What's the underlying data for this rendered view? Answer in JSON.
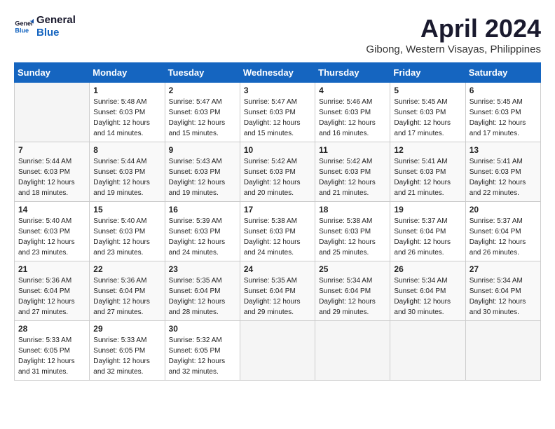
{
  "header": {
    "logo_line1": "General",
    "logo_line2": "Blue",
    "month_title": "April 2024",
    "subtitle": "Gibong, Western Visayas, Philippines"
  },
  "weekdays": [
    "Sunday",
    "Monday",
    "Tuesday",
    "Wednesday",
    "Thursday",
    "Friday",
    "Saturday"
  ],
  "weeks": [
    [
      {
        "day": "",
        "sunrise": "",
        "sunset": "",
        "daylight": ""
      },
      {
        "day": "1",
        "sunrise": "Sunrise: 5:48 AM",
        "sunset": "Sunset: 6:03 PM",
        "daylight": "Daylight: 12 hours and 14 minutes."
      },
      {
        "day": "2",
        "sunrise": "Sunrise: 5:47 AM",
        "sunset": "Sunset: 6:03 PM",
        "daylight": "Daylight: 12 hours and 15 minutes."
      },
      {
        "day": "3",
        "sunrise": "Sunrise: 5:47 AM",
        "sunset": "Sunset: 6:03 PM",
        "daylight": "Daylight: 12 hours and 15 minutes."
      },
      {
        "day": "4",
        "sunrise": "Sunrise: 5:46 AM",
        "sunset": "Sunset: 6:03 PM",
        "daylight": "Daylight: 12 hours and 16 minutes."
      },
      {
        "day": "5",
        "sunrise": "Sunrise: 5:45 AM",
        "sunset": "Sunset: 6:03 PM",
        "daylight": "Daylight: 12 hours and 17 minutes."
      },
      {
        "day": "6",
        "sunrise": "Sunrise: 5:45 AM",
        "sunset": "Sunset: 6:03 PM",
        "daylight": "Daylight: 12 hours and 17 minutes."
      }
    ],
    [
      {
        "day": "7",
        "sunrise": "Sunrise: 5:44 AM",
        "sunset": "Sunset: 6:03 PM",
        "daylight": "Daylight: 12 hours and 18 minutes."
      },
      {
        "day": "8",
        "sunrise": "Sunrise: 5:44 AM",
        "sunset": "Sunset: 6:03 PM",
        "daylight": "Daylight: 12 hours and 19 minutes."
      },
      {
        "day": "9",
        "sunrise": "Sunrise: 5:43 AM",
        "sunset": "Sunset: 6:03 PM",
        "daylight": "Daylight: 12 hours and 19 minutes."
      },
      {
        "day": "10",
        "sunrise": "Sunrise: 5:42 AM",
        "sunset": "Sunset: 6:03 PM",
        "daylight": "Daylight: 12 hours and 20 minutes."
      },
      {
        "day": "11",
        "sunrise": "Sunrise: 5:42 AM",
        "sunset": "Sunset: 6:03 PM",
        "daylight": "Daylight: 12 hours and 21 minutes."
      },
      {
        "day": "12",
        "sunrise": "Sunrise: 5:41 AM",
        "sunset": "Sunset: 6:03 PM",
        "daylight": "Daylight: 12 hours and 21 minutes."
      },
      {
        "day": "13",
        "sunrise": "Sunrise: 5:41 AM",
        "sunset": "Sunset: 6:03 PM",
        "daylight": "Daylight: 12 hours and 22 minutes."
      }
    ],
    [
      {
        "day": "14",
        "sunrise": "Sunrise: 5:40 AM",
        "sunset": "Sunset: 6:03 PM",
        "daylight": "Daylight: 12 hours and 23 minutes."
      },
      {
        "day": "15",
        "sunrise": "Sunrise: 5:40 AM",
        "sunset": "Sunset: 6:03 PM",
        "daylight": "Daylight: 12 hours and 23 minutes."
      },
      {
        "day": "16",
        "sunrise": "Sunrise: 5:39 AM",
        "sunset": "Sunset: 6:03 PM",
        "daylight": "Daylight: 12 hours and 24 minutes."
      },
      {
        "day": "17",
        "sunrise": "Sunrise: 5:38 AM",
        "sunset": "Sunset: 6:03 PM",
        "daylight": "Daylight: 12 hours and 24 minutes."
      },
      {
        "day": "18",
        "sunrise": "Sunrise: 5:38 AM",
        "sunset": "Sunset: 6:03 PM",
        "daylight": "Daylight: 12 hours and 25 minutes."
      },
      {
        "day": "19",
        "sunrise": "Sunrise: 5:37 AM",
        "sunset": "Sunset: 6:04 PM",
        "daylight": "Daylight: 12 hours and 26 minutes."
      },
      {
        "day": "20",
        "sunrise": "Sunrise: 5:37 AM",
        "sunset": "Sunset: 6:04 PM",
        "daylight": "Daylight: 12 hours and 26 minutes."
      }
    ],
    [
      {
        "day": "21",
        "sunrise": "Sunrise: 5:36 AM",
        "sunset": "Sunset: 6:04 PM",
        "daylight": "Daylight: 12 hours and 27 minutes."
      },
      {
        "day": "22",
        "sunrise": "Sunrise: 5:36 AM",
        "sunset": "Sunset: 6:04 PM",
        "daylight": "Daylight: 12 hours and 27 minutes."
      },
      {
        "day": "23",
        "sunrise": "Sunrise: 5:35 AM",
        "sunset": "Sunset: 6:04 PM",
        "daylight": "Daylight: 12 hours and 28 minutes."
      },
      {
        "day": "24",
        "sunrise": "Sunrise: 5:35 AM",
        "sunset": "Sunset: 6:04 PM",
        "daylight": "Daylight: 12 hours and 29 minutes."
      },
      {
        "day": "25",
        "sunrise": "Sunrise: 5:34 AM",
        "sunset": "Sunset: 6:04 PM",
        "daylight": "Daylight: 12 hours and 29 minutes."
      },
      {
        "day": "26",
        "sunrise": "Sunrise: 5:34 AM",
        "sunset": "Sunset: 6:04 PM",
        "daylight": "Daylight: 12 hours and 30 minutes."
      },
      {
        "day": "27",
        "sunrise": "Sunrise: 5:34 AM",
        "sunset": "Sunset: 6:04 PM",
        "daylight": "Daylight: 12 hours and 30 minutes."
      }
    ],
    [
      {
        "day": "28",
        "sunrise": "Sunrise: 5:33 AM",
        "sunset": "Sunset: 6:05 PM",
        "daylight": "Daylight: 12 hours and 31 minutes."
      },
      {
        "day": "29",
        "sunrise": "Sunrise: 5:33 AM",
        "sunset": "Sunset: 6:05 PM",
        "daylight": "Daylight: 12 hours and 32 minutes."
      },
      {
        "day": "30",
        "sunrise": "Sunrise: 5:32 AM",
        "sunset": "Sunset: 6:05 PM",
        "daylight": "Daylight: 12 hours and 32 minutes."
      },
      {
        "day": "",
        "sunrise": "",
        "sunset": "",
        "daylight": ""
      },
      {
        "day": "",
        "sunrise": "",
        "sunset": "",
        "daylight": ""
      },
      {
        "day": "",
        "sunrise": "",
        "sunset": "",
        "daylight": ""
      },
      {
        "day": "",
        "sunrise": "",
        "sunset": "",
        "daylight": ""
      }
    ]
  ]
}
